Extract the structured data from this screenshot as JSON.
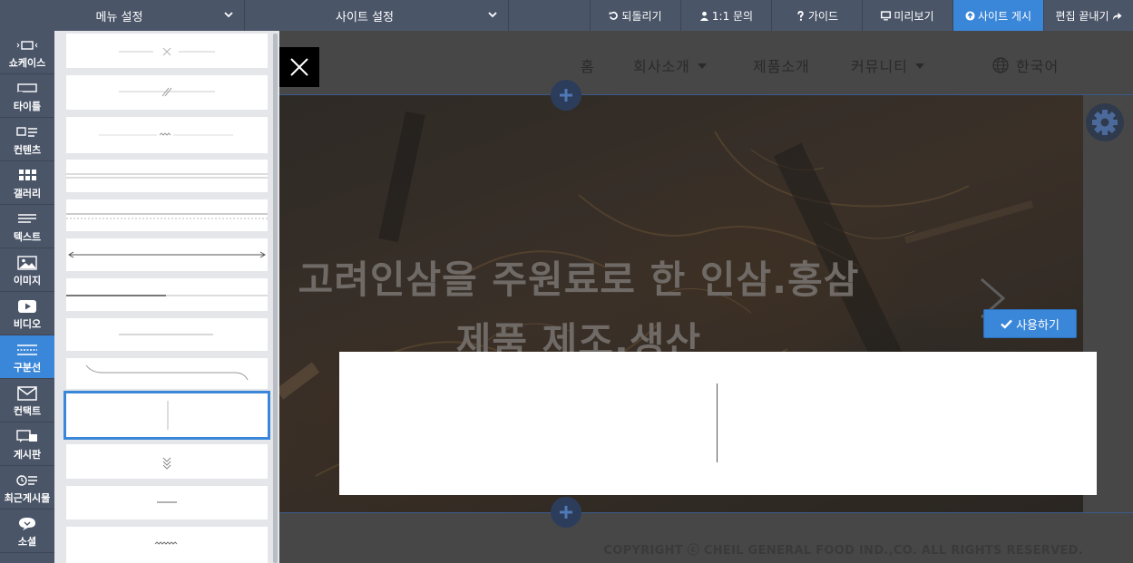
{
  "toolbar": {
    "menu_settings": "메뉴 설정",
    "site_settings": "사이트 설정",
    "undo": "되돌리기",
    "inquiry": "1:1 문의",
    "guide": "가이드",
    "preview": "미리보기",
    "publish": "사이트 게시",
    "finish_edit": "편집 끝내기"
  },
  "sidebar": {
    "items": [
      {
        "label": "쇼케이스",
        "icon": "showcase-icon"
      },
      {
        "label": "타이틀",
        "icon": "title-icon"
      },
      {
        "label": "컨텐츠",
        "icon": "content-icon"
      },
      {
        "label": "갤러리",
        "icon": "gallery-icon"
      },
      {
        "label": "텍스트",
        "icon": "text-icon"
      },
      {
        "label": "이미지",
        "icon": "image-icon"
      },
      {
        "label": "비디오",
        "icon": "video-icon"
      },
      {
        "label": "구분선",
        "icon": "divider-icon",
        "active": true
      },
      {
        "label": "컨택트",
        "icon": "mail-icon"
      },
      {
        "label": "게시판",
        "icon": "board-icon"
      },
      {
        "label": "최근게시물",
        "icon": "recent-posts-icon"
      },
      {
        "label": "소셜",
        "icon": "social-icon"
      }
    ]
  },
  "divider_panel": {
    "styles": [
      "line-with-x",
      "line-with-slash",
      "line-with-zigzag",
      "double-line",
      "dashed-line",
      "arrow-line",
      "thick-thin-line",
      "short-line",
      "curved-line",
      "vertical-line",
      "double-chevron",
      "short-center-line",
      "wavy-line"
    ],
    "selected": "vertical-line"
  },
  "site": {
    "nav": {
      "home": "홈",
      "about": "회사소개",
      "products": "제품소개",
      "community": "커뮤니티",
      "language": "한국어"
    },
    "hero": {
      "line1": "고려인삼을 주원료로 한 인삼.홍삼",
      "line2": "제품 제조.생산"
    },
    "copyright": "COPYRIGHT ⓒ CHEIL GENERAL FOOD IND.,CO. ALL RIGHTS RESERVED."
  },
  "use_button": "사용하기",
  "colors": {
    "toolbar": "#4a5568",
    "accent": "#3a86d8",
    "panel": "#e4e6ea"
  }
}
